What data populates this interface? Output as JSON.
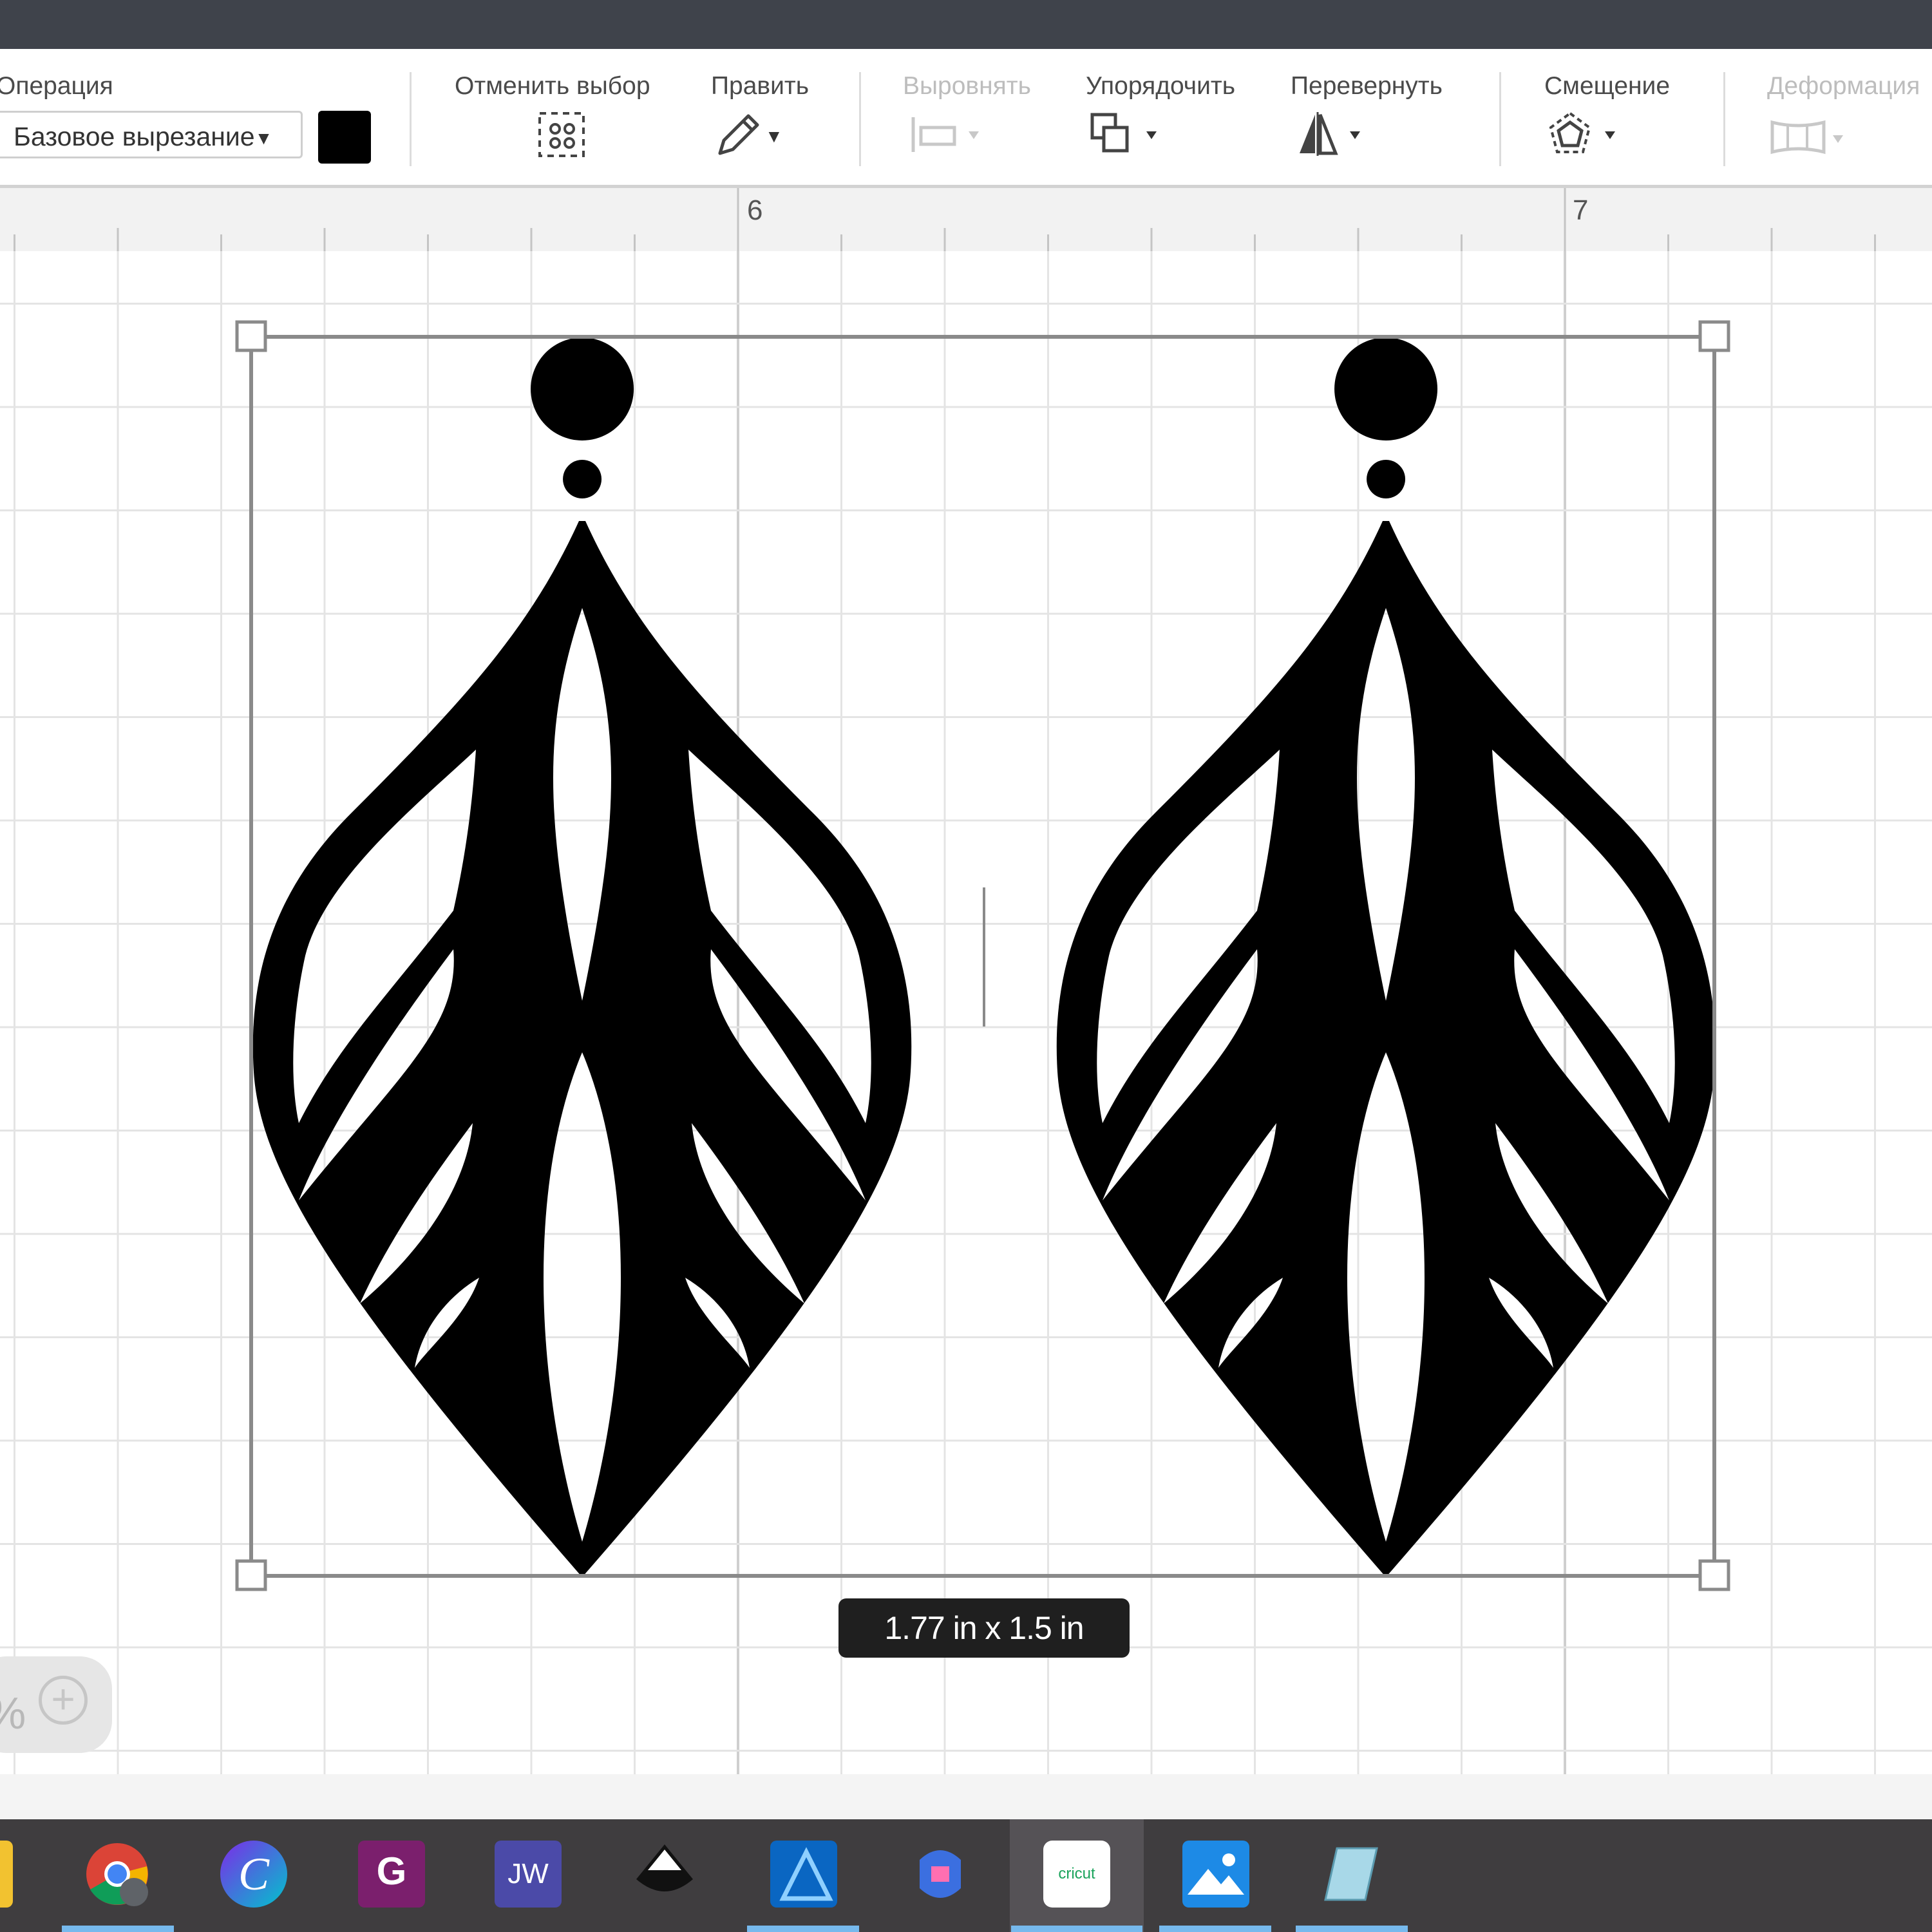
{
  "toolbar": {
    "operation": {
      "label": "Операция",
      "value": "Базовое вырезание",
      "color": "#000000"
    },
    "deselect": {
      "label": "Отменить выбор"
    },
    "edit": {
      "label": "Править"
    },
    "align": {
      "label": "Выровнять",
      "enabled": false
    },
    "arrange": {
      "label": "Упорядочить"
    },
    "flip": {
      "label": "Перевернуть"
    },
    "offset": {
      "label": "Смещение"
    },
    "warp": {
      "label": "Деформация",
      "enabled": false
    }
  },
  "ruler": {
    "labels": [
      "6",
      "7"
    ]
  },
  "selection": {
    "size_label": "1.77  in x 1.5  in",
    "object": "two leaf earrings"
  },
  "zoom": {
    "percent": "%"
  },
  "taskbar": {
    "apps": [
      {
        "name": "file-explorer"
      },
      {
        "name": "chrome"
      },
      {
        "name": "canva"
      },
      {
        "name": "pdf-app"
      },
      {
        "name": "jw-app"
      },
      {
        "name": "inkscape"
      },
      {
        "name": "affinity-designer"
      },
      {
        "name": "copilot"
      },
      {
        "name": "cricut",
        "label": "cricut",
        "active": true
      },
      {
        "name": "photos"
      },
      {
        "name": "notes-app"
      }
    ]
  }
}
